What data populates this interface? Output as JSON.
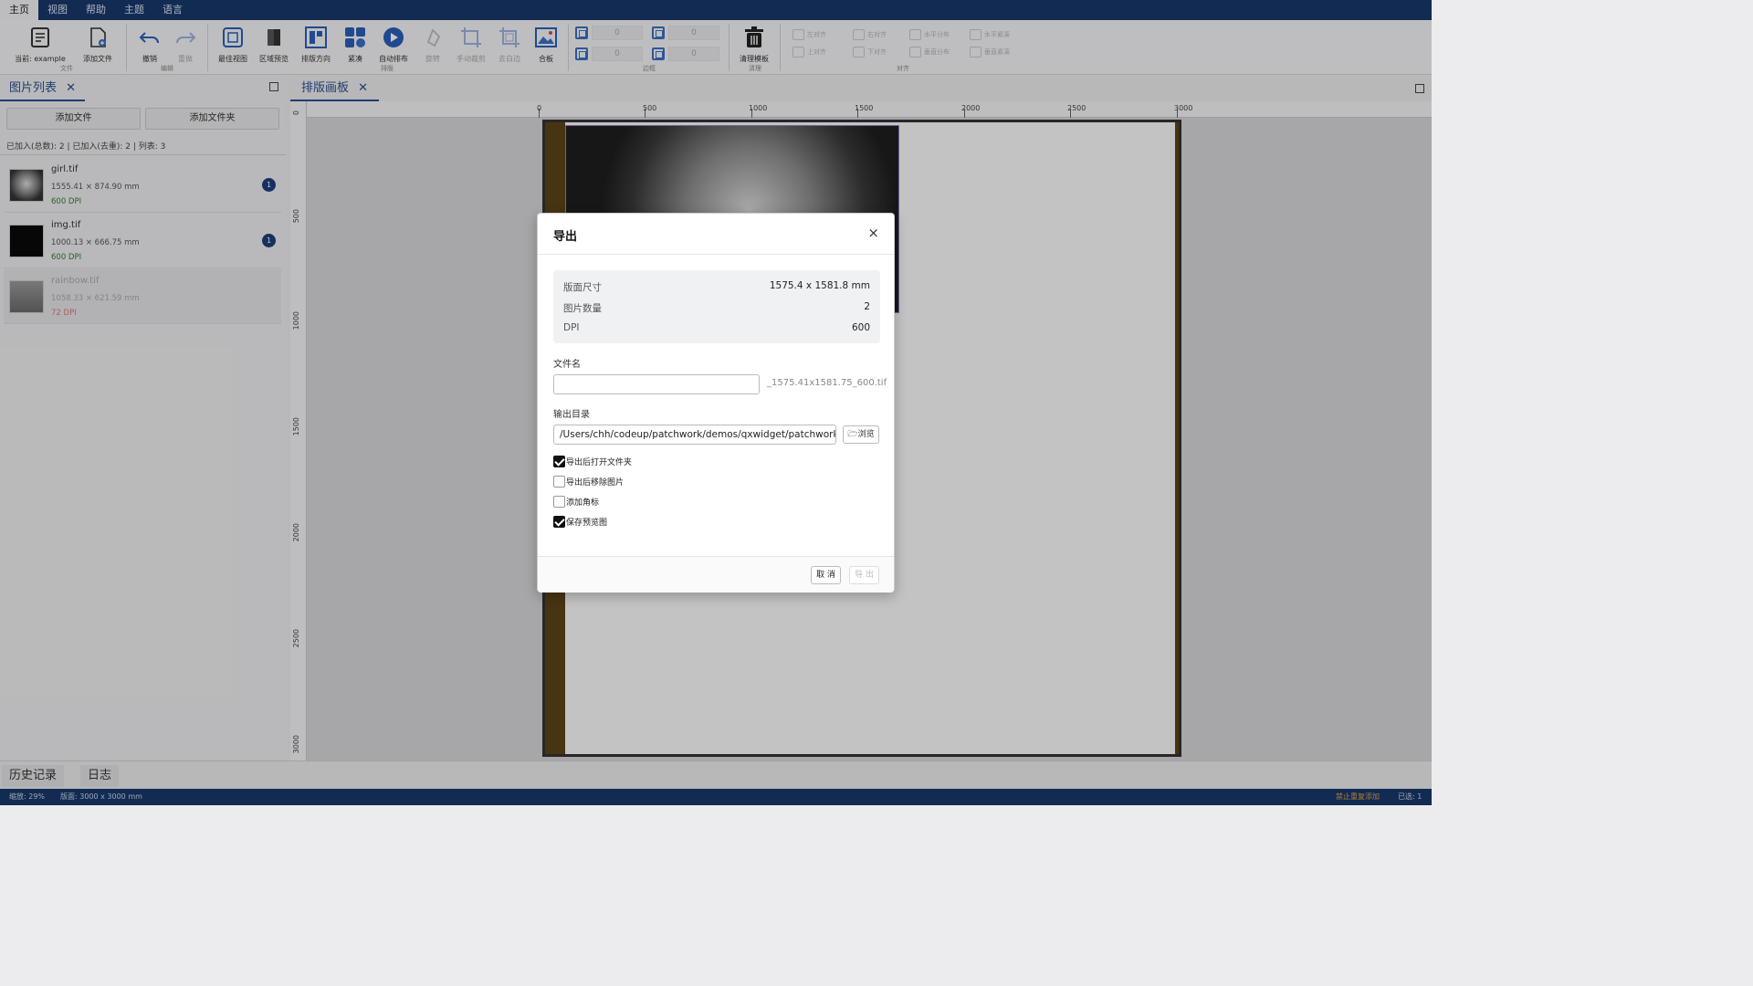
{
  "menu": [
    "主页",
    "视图",
    "帮助",
    "主题",
    "语言"
  ],
  "ribbon": {
    "current": "当前: example",
    "add_file": "添加文件",
    "group_file": "文件",
    "undo": "撤销",
    "redo": "重做",
    "group_edit": "编辑",
    "best_view": "最佳视图",
    "region_preview": "区域预览",
    "layout_direction": "排版方向",
    "compact": "紧凑",
    "auto_layout": "自动排布",
    "rotate": "旋转",
    "manual_crop": "手动裁剪",
    "auto_trim": "去白边",
    "merge": "合板",
    "group_layout": "排版",
    "margin_values": [
      "0",
      "0",
      "0",
      "0"
    ],
    "group_margin": "边框",
    "clear_template": "清理模板",
    "group_clear": "清理",
    "align": [
      "左对齐",
      "右对齐",
      "水平分布",
      "水平紧凑",
      "上对齐",
      "下对齐",
      "垂直分布",
      "垂直紧凑"
    ],
    "group_align": "对齐"
  },
  "left_panel": {
    "tab": "图片列表",
    "add_file_btn": "添加文件",
    "add_folder_btn": "添加文件夹",
    "info": "已加入(总数): 2 | 已加入(去重): 2 | 列表: 3",
    "files": [
      {
        "name": "girl.tif",
        "size": "1555.41 × 874.90 mm",
        "dpi": "600 DPI",
        "count": "1"
      },
      {
        "name": "img.tif",
        "size": "1000.13 × 666.75 mm",
        "dpi": "600 DPI",
        "count": "1"
      },
      {
        "name": "rainbow.tif",
        "size": "1058.33 × 621.59 mm",
        "dpi": "72 DPI",
        "count": ""
      }
    ]
  },
  "canvas": {
    "tab": "排版画板",
    "h_ticks": [
      "0",
      "500",
      "1000",
      "1500",
      "2000",
      "2500",
      "3000"
    ],
    "v_ticks": [
      "0",
      "500",
      "1000",
      "1500",
      "2000",
      "2500",
      "3000"
    ]
  },
  "dialog": {
    "title": "导出",
    "close": "×",
    "summary": [
      {
        "label": "版面尺寸",
        "value": "1575.4 x 1581.8 mm"
      },
      {
        "label": "图片数量",
        "value": "2"
      },
      {
        "label": "DPI",
        "value": "600"
      }
    ],
    "filename_label": "文件名",
    "filename_value": "",
    "filename_suffix": "_1575.41x1581.75_600.tif",
    "outdir_label": "输出目录",
    "outdir_value": "/Users/chh/codeup/patchwork/demos/qxwidget/patchwork/te",
    "browse": "浏览",
    "checkboxes": [
      {
        "label": "导出后打开文件夹",
        "checked": true
      },
      {
        "label": "导出后移除图片",
        "checked": false
      },
      {
        "label": "添加角标",
        "checked": false
      },
      {
        "label": "保存预览图",
        "checked": true
      }
    ],
    "cancel": "取 消",
    "export": "导 出"
  },
  "bottom": {
    "history": "历史记录",
    "log": "日志"
  },
  "status": {
    "zoom": "缩放: 29%",
    "page": "版面: 3000 x 3000 mm",
    "warn": "禁止重复添加",
    "selected": "已选: 1"
  },
  "colors": {
    "accent": "#17386b",
    "badge": "#1d3f7a",
    "dpi_ok": "#2e7d32",
    "dpi_bad": "#d87a7a"
  }
}
